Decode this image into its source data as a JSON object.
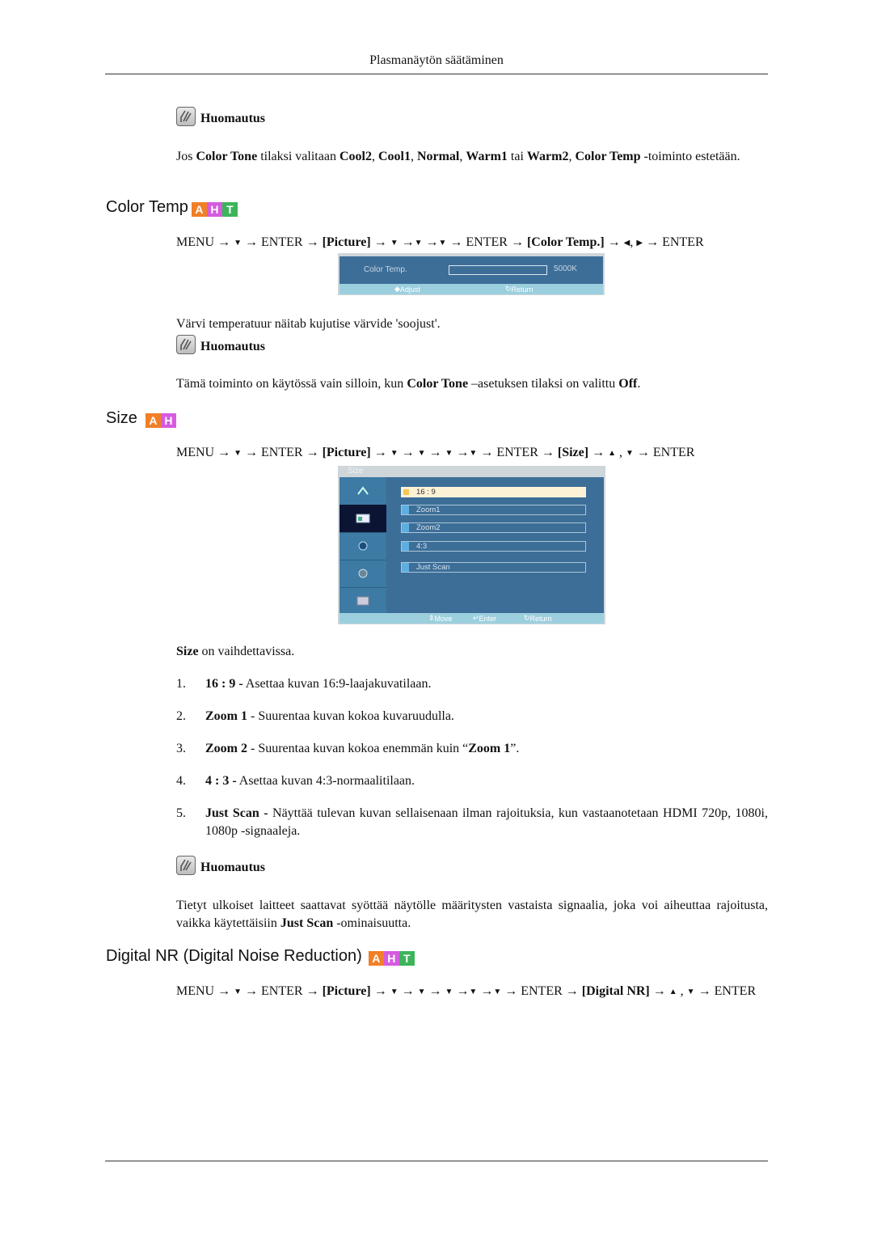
{
  "header": {
    "running_title": "Plasmanäytön säätäminen"
  },
  "note_label": "Huomautus",
  "intro_note": {
    "parts": [
      {
        "t": "Jos ",
        "b": false
      },
      {
        "t": "Color Tone",
        "b": true
      },
      {
        "t": " tilaksi valitaan ",
        "b": false
      },
      {
        "t": "Cool2",
        "b": true
      },
      {
        "t": ", ",
        "b": false
      },
      {
        "t": "Cool1",
        "b": true
      },
      {
        "t": ", ",
        "b": false
      },
      {
        "t": "Normal",
        "b": true
      },
      {
        "t": ", ",
        "b": false
      },
      {
        "t": "Warm1",
        "b": true
      },
      {
        "t": " tai ",
        "b": false
      },
      {
        "t": "Warm2",
        "b": true
      },
      {
        "t": ", ",
        "b": false
      },
      {
        "t": "Color Temp",
        "b": true
      },
      {
        "t": " -toiminto estetään.",
        "b": false
      }
    ]
  },
  "badges": {
    "a": "A",
    "h": "H",
    "t": "T"
  },
  "colors": {
    "badge_a": "#f07f28",
    "badge_h": "#d65be0",
    "badge_t": "#3cb45a",
    "osd_blue": "#3d6e98",
    "osd_footer": "#9ccfde"
  },
  "color_temp": {
    "title": "Color Temp",
    "nav": [
      {
        "t": "MENU → ",
        "b": false
      },
      {
        "t": "▼",
        "tri": true
      },
      {
        "t": " → ENTER → ",
        "b": false
      },
      {
        "t": "[Picture]",
        "b": true
      },
      {
        "t": " → ",
        "b": false
      },
      {
        "t": "▼",
        "tri": true
      },
      {
        "t": " →",
        "b": false
      },
      {
        "t": "▼",
        "tri": true
      },
      {
        "t": " →",
        "b": false
      },
      {
        "t": "▼",
        "tri": true
      },
      {
        "t": " → ENTER → ",
        "b": false
      },
      {
        "t": "[Color Temp.]",
        "b": true
      },
      {
        "t": " → ",
        "b": false
      },
      {
        "t": "◀",
        "tri": true
      },
      {
        "t": ", ",
        "b": false
      },
      {
        "t": "▶",
        "tri": true
      },
      {
        "t": " → ENTER",
        "b": false
      }
    ],
    "osd": {
      "label": "Color Temp.",
      "value": "5000K",
      "footer_adjust": "Adjust",
      "footer_return": "Return"
    },
    "description": "Värvi temperatuur näitab kujutise värvide 'soojust'.",
    "note": [
      {
        "t": "Tämä toiminto on käytössä vain silloin, kun ",
        "b": false
      },
      {
        "t": "Color Tone",
        "b": true
      },
      {
        "t": " –asetuksen tilaksi on valittu ",
        "b": false
      },
      {
        "t": "Off",
        "b": true
      },
      {
        "t": ".",
        "b": false
      }
    ]
  },
  "size": {
    "title": "Size",
    "nav": [
      {
        "t": "MENU → ",
        "b": false
      },
      {
        "t": "▼",
        "tri": true
      },
      {
        "t": " → ENTER → ",
        "b": false
      },
      {
        "t": "[Picture]",
        "b": true
      },
      {
        "t": " → ",
        "b": false
      },
      {
        "t": "▼",
        "tri": true
      },
      {
        "t": " → ",
        "b": false
      },
      {
        "t": "▼",
        "tri": true
      },
      {
        "t": " → ",
        "b": false
      },
      {
        "t": "▼",
        "tri": true
      },
      {
        "t": " →",
        "b": false
      },
      {
        "t": "▼",
        "tri": true
      },
      {
        "t": " → ENTER → ",
        "b": false
      },
      {
        "t": "[Size]",
        "b": true
      },
      {
        "t": " → ",
        "b": false
      },
      {
        "t": "▲",
        "tri": true
      },
      {
        "t": " , ",
        "b": false
      },
      {
        "t": "▼",
        "tri": true
      },
      {
        "t": " → ENTER",
        "b": false
      }
    ],
    "osd": {
      "title": "Size",
      "options": [
        "16 : 9",
        "Zoom1",
        "Zoom2",
        "4:3",
        "Just Scan"
      ],
      "selected_index": 0,
      "footer_move": "Move",
      "footer_enter": "Enter",
      "footer_return": "Return"
    },
    "intro_bold": "Size",
    "intro_rest": " on vaihdettavissa.",
    "items": [
      {
        "num": "1.",
        "bold": "16 : 9 -",
        "text": " Asettaa kuvan 16:9-laajakuvatilaan."
      },
      {
        "num": "2.",
        "bold": "Zoom 1",
        "text": " - Suurentaa kuvan kokoa kuvaruudulla."
      },
      {
        "num": "3.",
        "bold": "Zoom 2",
        "text": " - Suurentaa kuvan kokoa enemmän kuin “",
        "bold2": "Zoom 1",
        "text2": "”."
      },
      {
        "num": "4.",
        "bold": "4 : 3 -",
        "text": " Asettaa kuvan 4:3-normaalitilaan."
      },
      {
        "num": "5.",
        "bold": "Just Scan -",
        "text": " Näyttää tulevan kuvan sellaisenaan ilman rajoituksia, kun vastaanotetaan HDMI 720p, 1080i, 1080p -signaaleja."
      }
    ],
    "note": [
      {
        "t": "Tietyt ulkoiset laitteet saattavat syöttää näytölle määritysten vastaista signaalia, joka voi aiheuttaa rajoitusta, vaikka käytettäisiin ",
        "b": false
      },
      {
        "t": "Just Scan",
        "b": true
      },
      {
        "t": " -ominaisuutta.",
        "b": false
      }
    ]
  },
  "digital_nr": {
    "title": "Digital NR (Digital Noise Reduction)",
    "nav": [
      {
        "t": "MENU → ",
        "b": false
      },
      {
        "t": "▼",
        "tri": true
      },
      {
        "t": " → ENTER → ",
        "b": false
      },
      {
        "t": "[Picture]",
        "b": true
      },
      {
        "t": " → ",
        "b": false
      },
      {
        "t": "▼",
        "tri": true
      },
      {
        "t": " → ",
        "b": false
      },
      {
        "t": "▼",
        "tri": true
      },
      {
        "t": " → ",
        "b": false
      },
      {
        "t": "▼",
        "tri": true
      },
      {
        "t": " →",
        "b": false
      },
      {
        "t": "▼",
        "tri": true
      },
      {
        "t": " →",
        "b": false
      },
      {
        "t": "▼",
        "tri": true
      },
      {
        "t": " → ENTER → ",
        "b": false
      },
      {
        "t": "[Digital NR]",
        "b": true
      },
      {
        "t": " → ",
        "b": false
      },
      {
        "t": "▲",
        "tri": true
      },
      {
        "t": " , ",
        "b": false
      },
      {
        "t": "▼",
        "tri": true
      },
      {
        "t": " → ENTER",
        "b": false
      }
    ]
  }
}
